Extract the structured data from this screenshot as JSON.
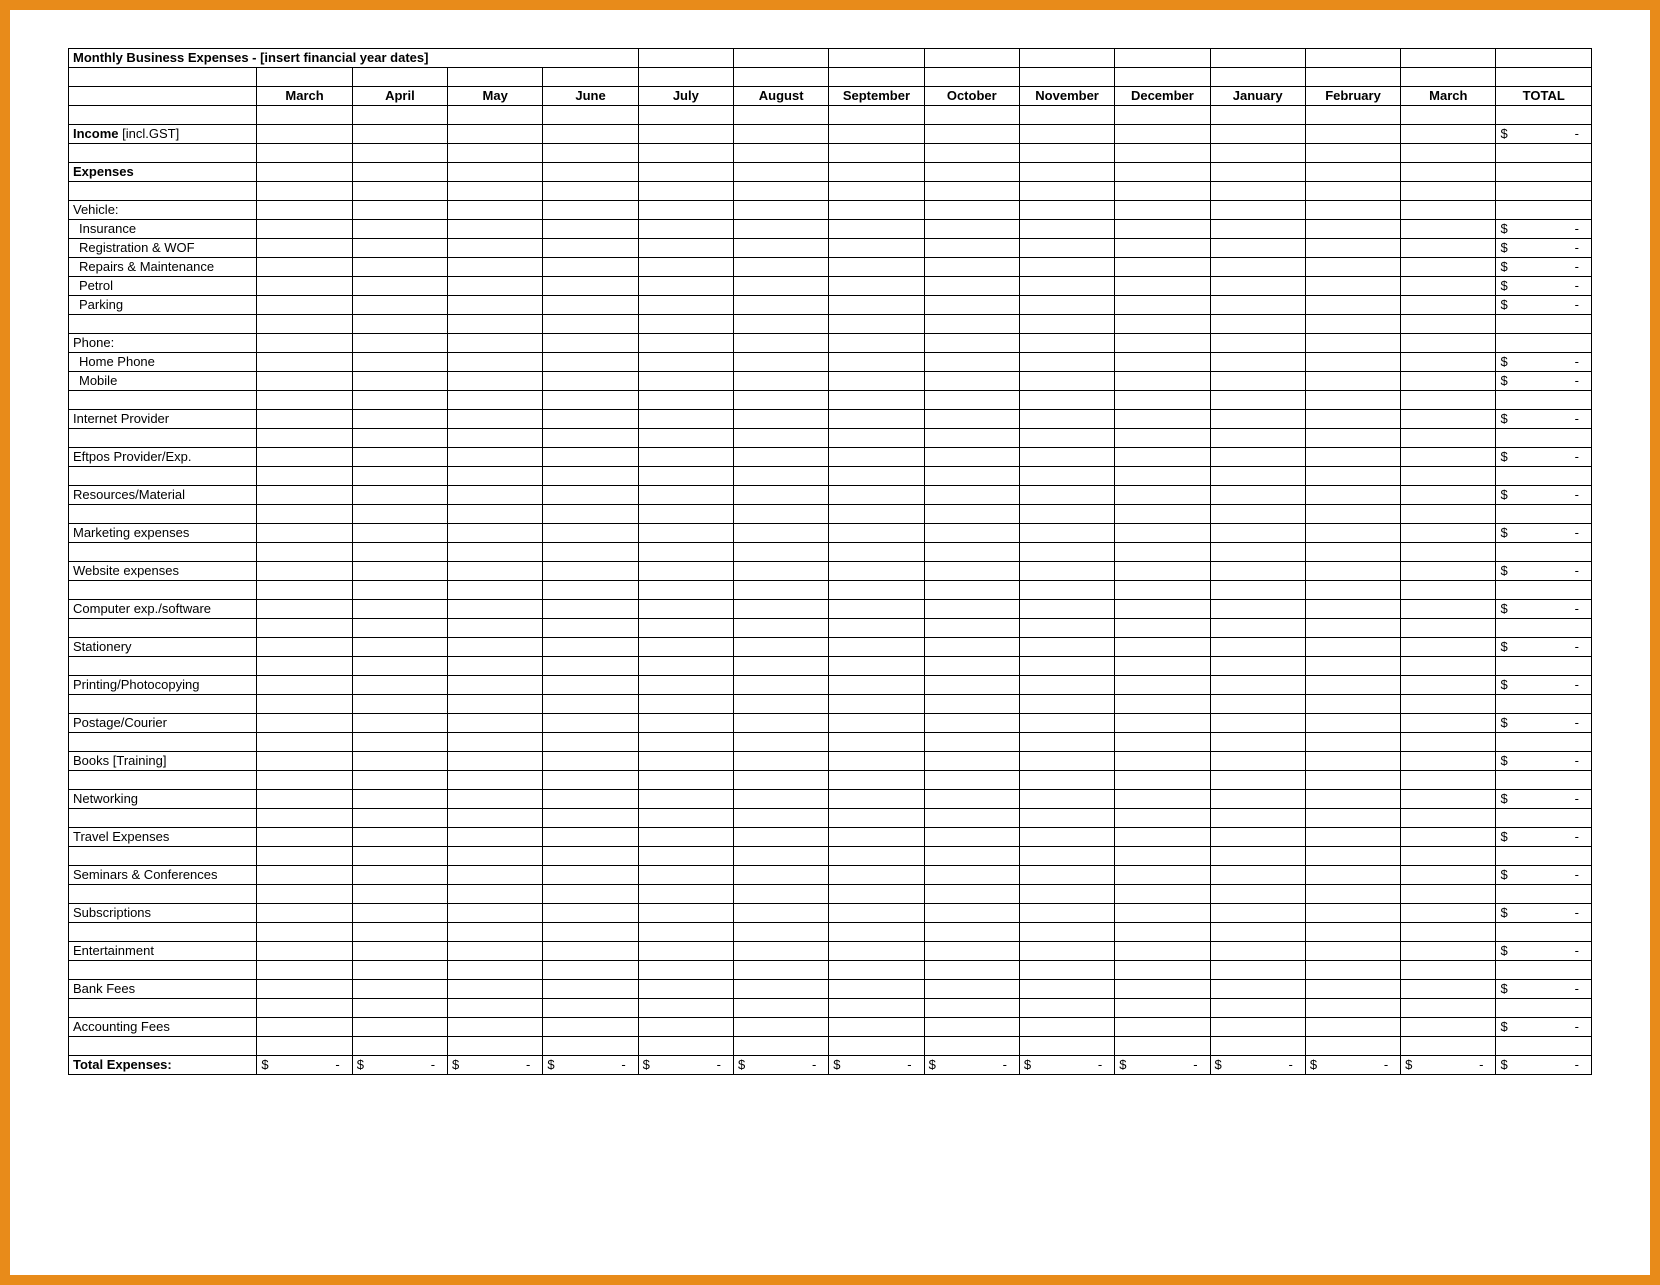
{
  "title": "Monthly Business Expenses - [insert financial year dates]",
  "months": [
    "March",
    "April",
    "May",
    "June",
    "July",
    "August",
    "September",
    "October",
    "November",
    "December",
    "January",
    "February",
    "March"
  ],
  "total_header": "TOTAL",
  "currency_symbol": "$",
  "dash": "-",
  "rows": [
    {
      "type": "spacer"
    },
    {
      "type": "item",
      "label_html": "<b>Income</b> [incl.GST]",
      "has_total": true
    },
    {
      "type": "spacer"
    },
    {
      "type": "section",
      "label": "Expenses"
    },
    {
      "type": "spacer"
    },
    {
      "type": "group",
      "label": "Vehicle:"
    },
    {
      "type": "sub",
      "label": "Insurance",
      "has_total": true
    },
    {
      "type": "sub",
      "label": "Registration & WOF",
      "has_total": true
    },
    {
      "type": "sub",
      "label": "Repairs & Maintenance",
      "has_total": true
    },
    {
      "type": "sub",
      "label": "Petrol",
      "has_total": true
    },
    {
      "type": "sub",
      "label": "Parking",
      "has_total": true
    },
    {
      "type": "spacer"
    },
    {
      "type": "group",
      "label": "Phone:"
    },
    {
      "type": "sub",
      "label": "Home Phone",
      "has_total": true
    },
    {
      "type": "sub",
      "label": "Mobile",
      "has_total": true
    },
    {
      "type": "spacer"
    },
    {
      "type": "item",
      "label": "Internet Provider",
      "has_total": true
    },
    {
      "type": "spacer"
    },
    {
      "type": "item",
      "label": "Eftpos Provider/Exp.",
      "has_total": true
    },
    {
      "type": "spacer"
    },
    {
      "type": "item",
      "label": "Resources/Material",
      "has_total": true
    },
    {
      "type": "spacer"
    },
    {
      "type": "item",
      "label": "Marketing expenses",
      "has_total": true
    },
    {
      "type": "spacer"
    },
    {
      "type": "item",
      "label": "Website expenses",
      "has_total": true
    },
    {
      "type": "spacer"
    },
    {
      "type": "item",
      "label": "Computer exp./software",
      "has_total": true
    },
    {
      "type": "spacer"
    },
    {
      "type": "item",
      "label": "Stationery",
      "has_total": true
    },
    {
      "type": "spacer"
    },
    {
      "type": "item",
      "label": "Printing/Photocopying",
      "has_total": true
    },
    {
      "type": "spacer"
    },
    {
      "type": "item",
      "label": "Postage/Courier",
      "has_total": true
    },
    {
      "type": "spacer"
    },
    {
      "type": "item",
      "label": "Books [Training]",
      "has_total": true
    },
    {
      "type": "spacer"
    },
    {
      "type": "item",
      "label": "Networking",
      "has_total": true
    },
    {
      "type": "spacer"
    },
    {
      "type": "item",
      "label": "Travel Expenses",
      "has_total": true
    },
    {
      "type": "spacer"
    },
    {
      "type": "item",
      "label": "Seminars & Conferences",
      "has_total": true
    },
    {
      "type": "spacer"
    },
    {
      "type": "item",
      "label": "Subscriptions",
      "has_total": true
    },
    {
      "type": "spacer"
    },
    {
      "type": "item",
      "label": "Entertainment",
      "has_total": true
    },
    {
      "type": "spacer"
    },
    {
      "type": "item",
      "label": "Bank Fees",
      "has_total": true
    },
    {
      "type": "spacer"
    },
    {
      "type": "item",
      "label": "Accounting Fees",
      "has_total": true
    },
    {
      "type": "spacer"
    },
    {
      "type": "total",
      "label": "Total Expenses:"
    }
  ]
}
